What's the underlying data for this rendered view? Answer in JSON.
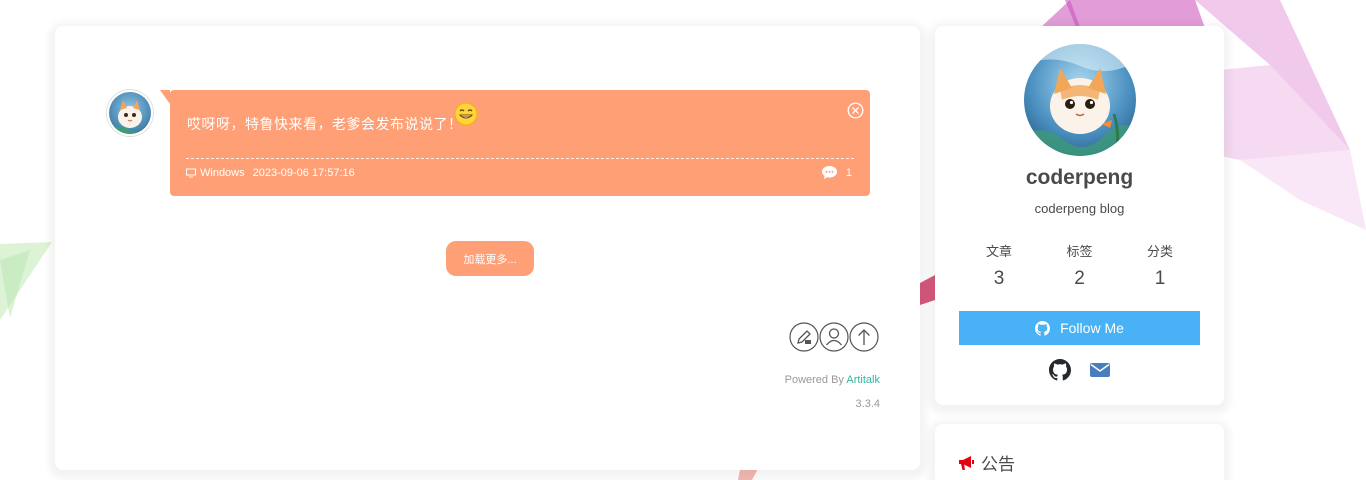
{
  "talk": {
    "text": "哎呀呀，特鲁快来看，老爹会发布说说了！",
    "device": "Windows",
    "datetime": "2023-09-06 17:57:16",
    "comment_count": "1"
  },
  "load_more_label": "加载更多...",
  "footer": {
    "powered_prefix": "Powered By ",
    "powered_link": "Artitalk",
    "version": "3.3.4"
  },
  "profile": {
    "name": "coderpeng",
    "description": "coderpeng blog",
    "stats": [
      {
        "label": "文章",
        "count": "3"
      },
      {
        "label": "标签",
        "count": "2"
      },
      {
        "label": "分类",
        "count": "1"
      }
    ],
    "follow_label": "Follow Me"
  },
  "notice": {
    "title": "公告"
  },
  "colors": {
    "accent": "#ff9f76",
    "follow": "#49b1f5",
    "link": "#2fb8a2",
    "notice_icon": "#e60012"
  },
  "icons": {
    "close": "close-circle-icon",
    "device": "monitor-icon",
    "comment": "comment-icon",
    "edit": "edit-icon",
    "user": "user-icon",
    "top": "arrow-up-icon",
    "github": "github-icon",
    "mail": "envelope-icon",
    "notice": "bullhorn-icon"
  }
}
